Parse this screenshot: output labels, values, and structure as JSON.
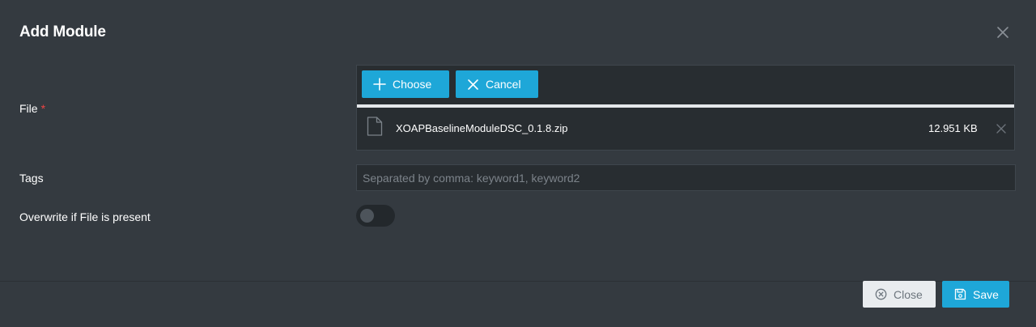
{
  "dialog": {
    "title": "Add Module"
  },
  "fields": {
    "file_label": "File",
    "required_marker": "*",
    "tags_label": "Tags",
    "overwrite_label": "Overwrite if File is present"
  },
  "upload": {
    "choose_label": "Choose",
    "cancel_label": "Cancel",
    "progress": 1.0,
    "file": {
      "name": "XOAPBaselineModuleDSC_0.1.8.zip",
      "size": "12.951 KB"
    }
  },
  "tags": {
    "value": "",
    "placeholder": "Separated by comma: keyword1, keyword2"
  },
  "overwrite": {
    "enabled": false
  },
  "footer": {
    "close_label": "Close",
    "save_label": "Save"
  },
  "colors": {
    "background": "#343a40",
    "accent": "#1ea7d8",
    "required": "#ef4444",
    "input_background": "#282d31"
  },
  "icons": {
    "dialog_close": "close-icon",
    "choose": "plus-icon",
    "cancel": "close-icon",
    "file": "file-icon",
    "remove_file": "close-icon",
    "close_button": "circle-x-icon",
    "save_button": "floppy-disk-icon"
  }
}
